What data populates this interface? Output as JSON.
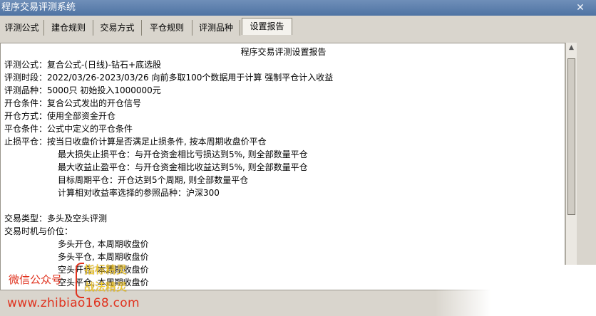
{
  "window": {
    "title": "程序交易评测系统",
    "close_label": "✕"
  },
  "tabs": [
    {
      "label": "评测公式"
    },
    {
      "label": "建仓规则"
    },
    {
      "label": "交易方式"
    },
    {
      "label": "平仓规则"
    },
    {
      "label": "评测品种"
    },
    {
      "label": "设置报告"
    }
  ],
  "report": {
    "heading": "程序交易评测设置报告",
    "lines": [
      "评测公式：复合公式-(日线)-钻石+底选股",
      "评测时段：2022/03/26-2023/03/26 向前多取100个数据用于计算 强制平仓计入收益",
      "评测品种：5000只 初始投入1000000元",
      "开仓条件：复合公式发出的开仓信号",
      "开仓方式：使用全部资金开仓",
      "平仓条件：公式中定义的平仓条件",
      "止损平仓：按当日收盘价计算是否满足止损条件, 按本周期收盘价平仓",
      "最大损失止损平仓：与开仓资金相比亏损达到5%, 则全部数量平仓",
      "最大收益止盈平仓：与开仓资金相比收益达到5%, 则全部数量平仓",
      "目标周期平仓：开仓达到5个周期, 则全部数量平仓",
      "计算相对收益率选择的参照品种：沪深300",
      "交易类型：多头及空头评测",
      "交易时机与价位：",
      "多头开仓, 本周期收盘价",
      "多头平仓, 本周期收盘价",
      "空头开仓, 本周期收盘价",
      "空头平仓, 本周期收盘价"
    ]
  },
  "watermark": {
    "label": "微信公众号",
    "name1": "指标精灵",
    "name2": "战法精灵",
    "url": "www.zhibiao168.com"
  }
}
